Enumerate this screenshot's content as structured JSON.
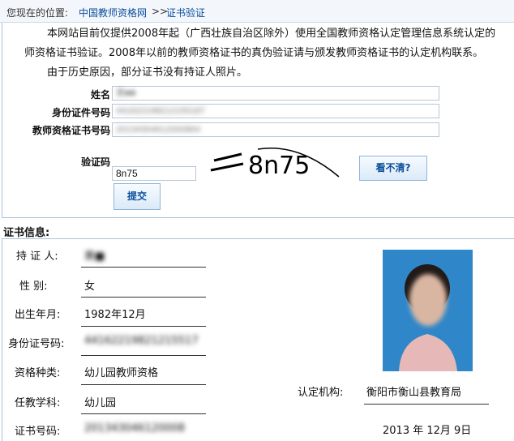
{
  "breadcrumb": {
    "here": "您现在的位置:",
    "home": "中国教师资格网",
    "sep": ">>",
    "current": "证书验证"
  },
  "intro": {
    "line1": "本网站目前仅提供2008年起（广西壮族自治区除外）使用全国教师资格认定管理信息系统认定的",
    "line2": "师资格证书验证。2008年以前的教师资格证书的真伪验证请与颁发教师资格证书的认定机构联系。",
    "line3": "由于历史原因，部分证书没有持证人照片。"
  },
  "form": {
    "name_label": "姓名",
    "name_value": "黄■■",
    "id_label": "身份证件号码",
    "id_value": "441622198212155187",
    "cert_label": "教师资格证书号码",
    "cert_value": "20134304612000864",
    "captcha_label": "验证码",
    "captcha_text": "8n75",
    "captcha_value": "8n75",
    "refresh_label": "看不清?",
    "submit_label": "提交"
  },
  "info": {
    "title": "证书信息:",
    "holder_label": "持 证 人:",
    "holder_value": "黄■",
    "gender_label": "性    别:",
    "gender_value": "女",
    "birth_label": "出生年月:",
    "birth_value": "1982年12月",
    "idno_label": "身份证号码:",
    "idno_value": "44162219821215517",
    "type_label": "资格种类:",
    "type_value": "幼儿园教师资格",
    "subject_label": "任教学科:",
    "subject_value": "幼儿园",
    "certno_label": "证书号码:",
    "certno_value": "201343046120008",
    "org_label": "认定机构:",
    "org_value": "衡阳市衡山县教育局",
    "date_value": "2013 年  12月  9日"
  },
  "colors": {
    "link": "#0a4d9c",
    "border": "#a9c3df",
    "photo_bg": "#2f86c8"
  }
}
